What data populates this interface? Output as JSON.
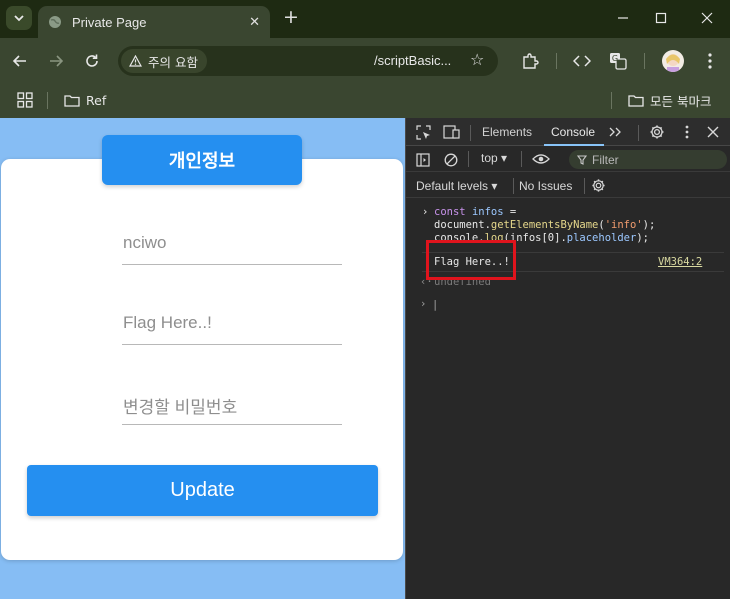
{
  "browser": {
    "tab_title": "Private Page",
    "security_chip": "주의 요함",
    "url": "/scriptBasic...",
    "bookmarks": [
      {
        "label": "Ref"
      },
      {
        "label": "모든 북마크"
      }
    ]
  },
  "page": {
    "header_title": "개인정보",
    "fields": [
      {
        "placeholder": "nciwo"
      },
      {
        "placeholder": "Flag Here..!"
      },
      {
        "placeholder": "변경할 비밀번호"
      }
    ],
    "update_label": "Update"
  },
  "devtools": {
    "tabs": [
      "Elements",
      "Console"
    ],
    "active_tab": "Console",
    "context": "top",
    "filter_placeholder": "Filter",
    "levels": "Default levels",
    "issues": "No Issues",
    "console": {
      "line1_kw": "const",
      "line1_var": "infos",
      "line1_eq": " =",
      "line2_obj": "document.",
      "line2_fn": "getElementsByName",
      "line2_open": "(",
      "line2_str": "'info'",
      "line2_close": ");",
      "line3_obj": "console.",
      "line3_fn": "log",
      "line3_args": "(infos[0].",
      "line3_prop": "placeholder",
      "line3_close": ");",
      "output": "Flag Here..!",
      "source": "VM364:2",
      "return_value": "undefined"
    },
    "highlight_color": "#e0141d"
  }
}
